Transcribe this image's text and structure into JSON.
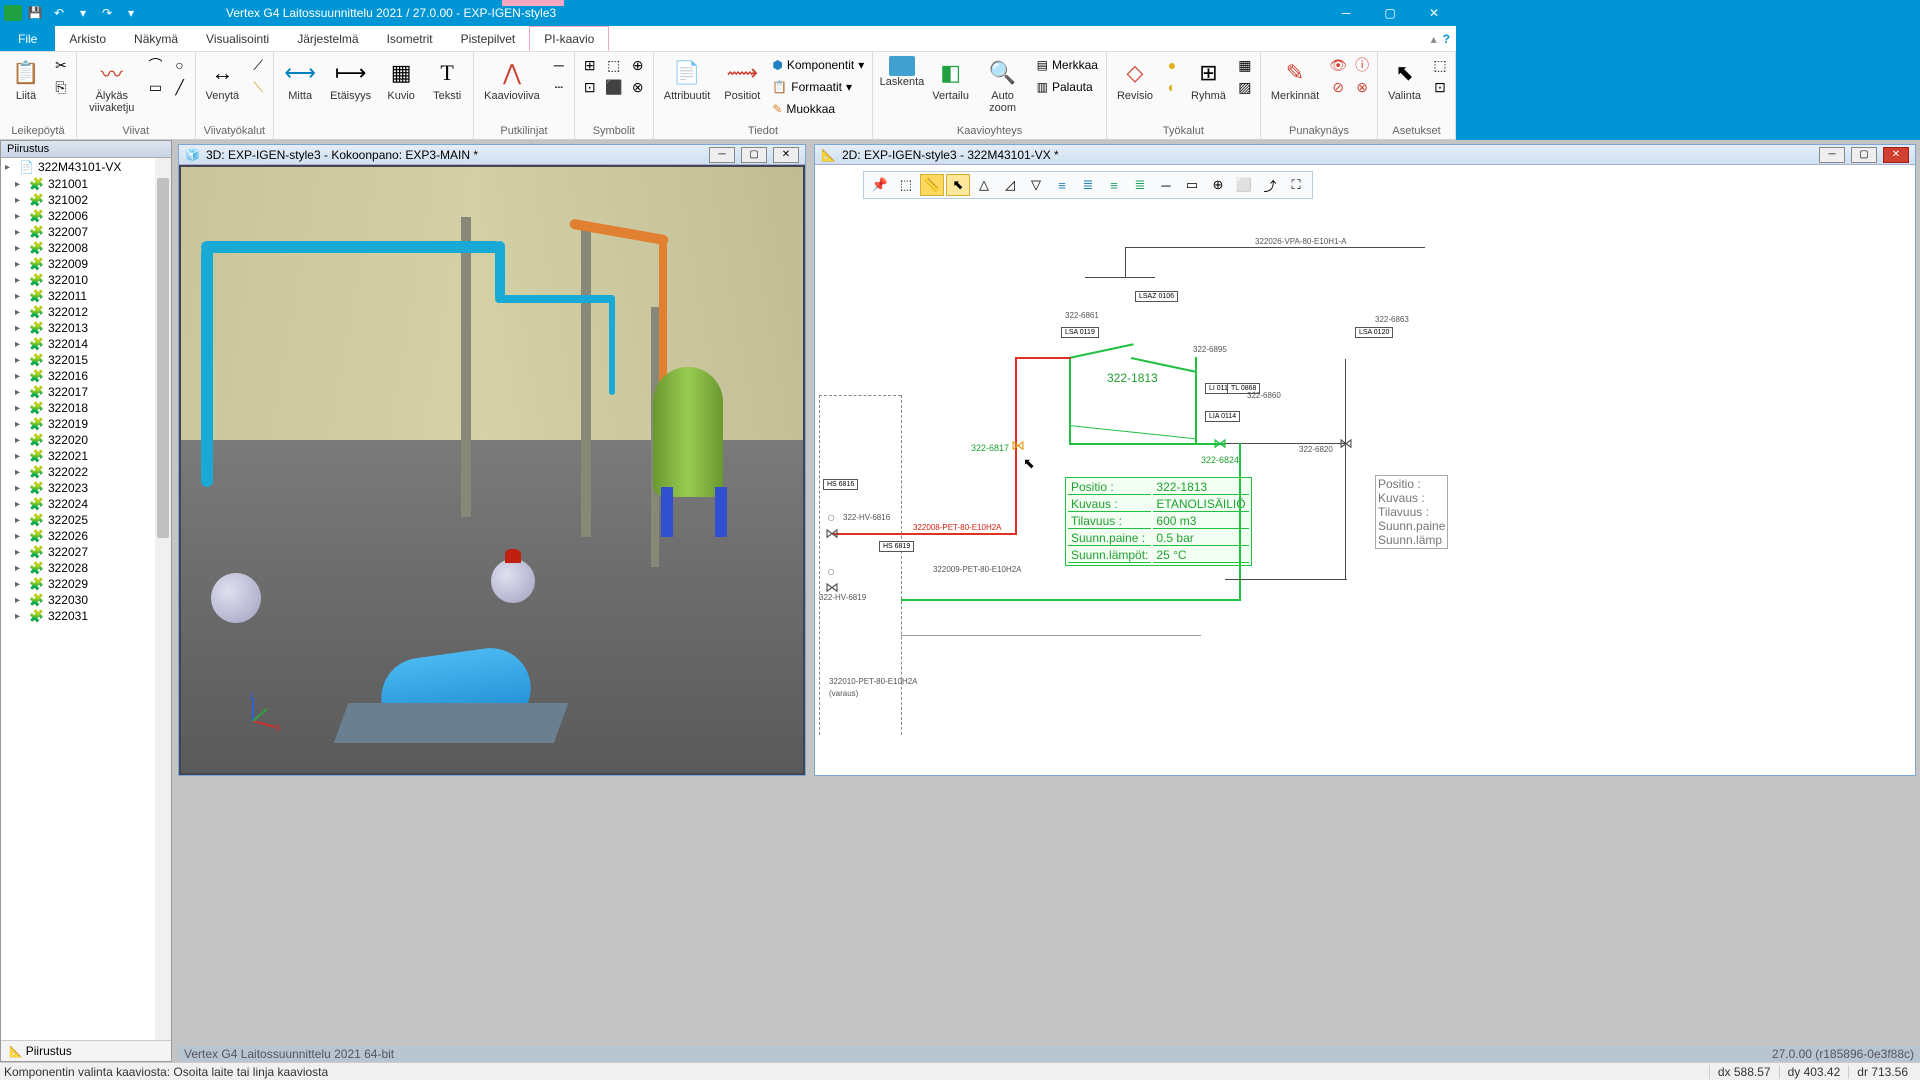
{
  "app": {
    "title": "Vertex G4 Laitossuunnittelu 2021 / 27.0.00 - EXP-IGEN-style3"
  },
  "tabs": {
    "file": "File",
    "list": [
      "Arkisto",
      "Näkymä",
      "Visualisointi",
      "Järjestelmä",
      "Isometrit",
      "Pistepilvet",
      "PI-kaavio"
    ],
    "active": "PI-kaavio"
  },
  "ribbon": {
    "groups": {
      "leike": {
        "label": "Leikepöytä",
        "paste": "Liitä"
      },
      "viivat": {
        "label": "Viivat",
        "smart": "Älykäs\nviivaketju"
      },
      "viivatyokalut": {
        "label": "Viivatyökalut",
        "stretch": "Venytä"
      },
      "mitat": {
        "mitta": "Mitta",
        "etaisyys": "Etäisyys",
        "kuvio": "Kuvio",
        "teksti": "Teksti"
      },
      "putki": {
        "label": "Putkilinjat",
        "kaavio": "Kaavioviiva"
      },
      "symbolit": {
        "label": "Symbolit"
      },
      "tiedot": {
        "label": "Tiedot",
        "attr": "Attribuutit",
        "pos": "Positiot",
        "komp": "Komponentit",
        "form": "Formaatit",
        "muok": "Muokkaa"
      },
      "kaavio": {
        "label": "Kaavioyhteys",
        "lask": "Laskenta",
        "vert": "Vertailu",
        "auto": "Auto\nzoom",
        "merk": "Merkkaa",
        "pal": "Palauta"
      },
      "tyokalut": {
        "label": "Työkalut",
        "rev": "Revisio",
        "ryh": "Ryhmä"
      },
      "puna": {
        "label": "Punakynäys",
        "merk": "Merkinnät"
      },
      "aset": {
        "label": "Asetukset",
        "val": "Valinta"
      }
    }
  },
  "tree": {
    "title": "Piirustus",
    "root": "322M43101-VX",
    "items": [
      "321001",
      "321002",
      "322006",
      "322007",
      "322008",
      "322009",
      "322010",
      "322011",
      "322012",
      "322013",
      "322014",
      "322015",
      "322016",
      "322017",
      "322018",
      "322019",
      "322020",
      "322021",
      "322022",
      "322023",
      "322024",
      "322025",
      "322026",
      "322027",
      "322028",
      "322029",
      "322030",
      "322031"
    ],
    "tab": "Piirustus"
  },
  "doc3d": {
    "title": "3D: EXP-IGEN-style3 - Kokoonpano: EXP3-MAIN *"
  },
  "doc2d": {
    "title": "2D: EXP-IGEN-style3 - 322M43101-VX *"
  },
  "diagram": {
    "tankId": "322-1813",
    "labels": {
      "l1": "322026-VPA-80-E10H1-A",
      "l2": "322-6861",
      "l3": "322-6895",
      "l4": "322-6860",
      "l5": "322-6820",
      "l6": "322-6817",
      "l7": "322-6824",
      "l8": "322-6863",
      "hv1": "322-HV-6816",
      "hv2": "322-HV-6819",
      "pet1": "322008-PET-80-E10H2A",
      "pet2": "322009-PET-80-E10H2A",
      "pet3": "322010-PET-80-E10H2A",
      "varaus": "(varaus)",
      "lsaz": "LSAZ\n0106",
      "lsa1": "LSA\n0119",
      "lsa2": "LSA\n0120",
      "li": "LI\n0113",
      "tl": "TL\n0868",
      "lia": "LIA\n0114",
      "hs1": "HS\n6816",
      "hs2": "HS\n6819"
    },
    "info": {
      "r1k": "Positio :",
      "r1v": "322-1813",
      "r2k": "Kuvaus :",
      "r2v": "ETANOLISÄILIÖ",
      "r3k": "Tilavuus :",
      "r3v": "600 m3",
      "r4k": "Suunn.paine :",
      "r4v": "0.5 bar",
      "r5k": "Suunn.lämpöt:",
      "r5v": "25 °C"
    },
    "info2": {
      "r1": "Positio :",
      "r2": "Kuvaus :",
      "r3": "Tilavuus :",
      "r4": "Suunn.paine",
      "r5": "Suunn.lämp"
    }
  },
  "footer": {
    "left": "Vertex G4 Laitossuunnittelu 2021 64-bit",
    "right": "27.0.00 (r185896-0e3f88c)"
  },
  "status": {
    "msg": "Komponentin valinta kaaviosta: Osoita laite tai linja kaaviosta",
    "dx": "dx 588.57",
    "dy": "dy 403.42",
    "dr": "dr 713.56"
  }
}
